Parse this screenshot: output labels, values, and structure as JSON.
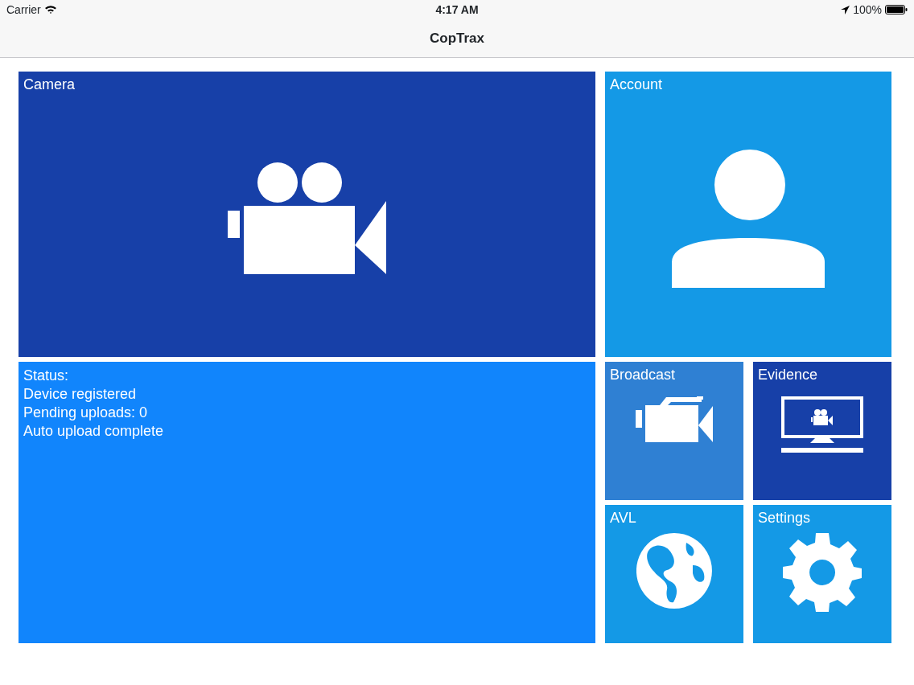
{
  "status_bar": {
    "carrier": "Carrier",
    "time": "4:17 AM",
    "battery": "100%"
  },
  "nav_title": "CopTrax",
  "tiles": [
    {
      "kind": "camera",
      "label": "Camera",
      "color": "#1740a8"
    },
    {
      "kind": "account",
      "label": "Account",
      "color": "#1499e6"
    },
    {
      "kind": "status",
      "lines": [
        "Status:",
        "Device registered",
        "Pending uploads: 0",
        "Auto upload complete"
      ],
      "color": "#1185fc"
    },
    {
      "kind": "broadcast",
      "label": "Broadcast",
      "color": "#2f80d3"
    },
    {
      "kind": "evidence",
      "label": "Evidence",
      "color": "#1740a8"
    },
    {
      "kind": "avl",
      "label": "AVL",
      "color": "#1499e6"
    },
    {
      "kind": "settings",
      "label": "Settings",
      "color": "#1499e6"
    }
  ]
}
